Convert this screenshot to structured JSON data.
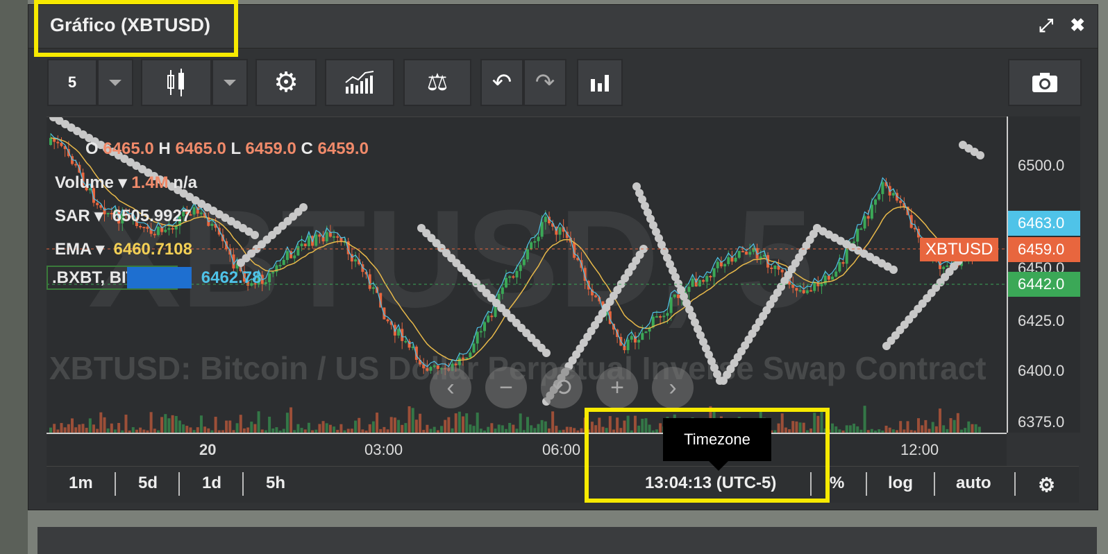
{
  "panel": {
    "title": "Gráfico (XBTUSD)",
    "maximize_icon": "expand-icon",
    "close_icon": "close-icon"
  },
  "toolbar": {
    "interval": "5",
    "chart_type_icon": "candlestick-icon",
    "settings_icon": "gear-icon",
    "indicators_icon": "indicators-icon",
    "compare_icon": "balance-scale-icon",
    "undo_icon": "undo-icon",
    "redo_icon": "redo-icon",
    "depth_icon": "bar-chart-icon",
    "snapshot_icon": "camera-icon"
  },
  "legend": {
    "o_label": "O",
    "o_value": "6465.0",
    "h_label": "H",
    "h_value": "6465.0",
    "l_label": "L",
    "l_value": "6459.0",
    "c_label": "C",
    "c_value": "6459.0",
    "volume_label": "Volume",
    "volume_value": "1.4M",
    "volume_extra": "n/a",
    "sar_label": "SAR",
    "sar_value": "6505.9927",
    "ema_label": "EMA",
    "ema_value": "6460.7108",
    "bxbt_label": ".BXBT, BITMEX",
    "bxbt_value": "6462.78"
  },
  "watermark": {
    "symbol": "XBTUSD, 5",
    "description": "XBTUSD: Bitcoin / US Dollar Perpetual Inverse Swap Contract"
  },
  "yaxis": {
    "ticks": [
      "6500.0",
      "6450.0",
      "6425.0",
      "6400.0",
      "6375.0"
    ],
    "badges": [
      {
        "label": "6463.0",
        "color": "#4fc3e8"
      },
      {
        "label": "6459.0",
        "color": "#e8663e"
      },
      {
        "label": "6442.0",
        "color": "#3ba857"
      }
    ],
    "symbol_badge": "XBTUSD"
  },
  "xaxis": {
    "ticks": [
      "20",
      "03:00",
      "06:00",
      "12:00"
    ]
  },
  "footer": {
    "ranges": [
      "1m",
      "5d",
      "1d",
      "5h"
    ],
    "clock": "13:04:13 (UTC-5)",
    "percent": "%",
    "log": "log",
    "auto": "auto",
    "settings_icon": "gear-icon"
  },
  "tooltip": "Timezone",
  "nav": [
    "‹",
    "−",
    "⟲",
    "+",
    "›"
  ],
  "colors": {
    "up": "#3ba857",
    "down": "#e8663e",
    "ema": "#e8b94a",
    "compare": "#4fc3e8",
    "highlight": "#f7ea00"
  }
}
